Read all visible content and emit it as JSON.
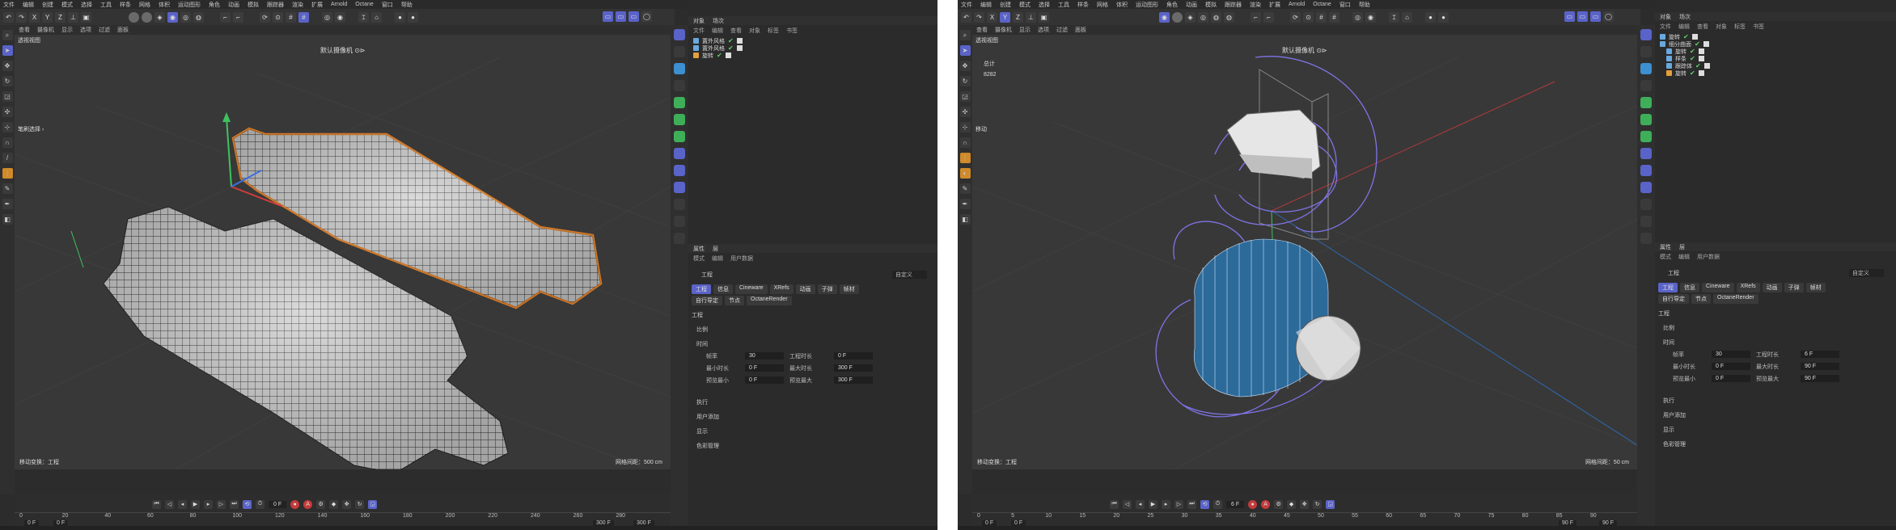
{
  "left": {
    "menu": [
      "文件",
      "编辑",
      "创建",
      "模式",
      "选择",
      "工具",
      "样条",
      "网格",
      "体积",
      "运动图形",
      "角色",
      "动画",
      "模拟",
      "跟踪器",
      "渲染",
      "扩展",
      "Arnold",
      "Octane",
      "窗口",
      "帮助"
    ],
    "toolbar": [
      "X",
      "Y",
      "Z"
    ],
    "viewport": {
      "menu": [
        "查看",
        "摄像机",
        "显示",
        "选项",
        "过滤",
        "面板"
      ],
      "title": "透视视图",
      "camera": "默认摄像机 ⊙⊳",
      "brush_label": "笔刷选择 ›",
      "status": "移动变换：工程",
      "grid_info": "网格间距：500 cm"
    },
    "timeline": {
      "frame": "0 F",
      "ticks": [
        "0",
        "20",
        "40",
        "60",
        "80",
        "100",
        "120",
        "140",
        "160",
        "180",
        "200",
        "220",
        "240",
        "260",
        "280"
      ],
      "range_start": "0 F",
      "range_mid": "0 F",
      "range_end1": "300 F",
      "range_end2": "300 F"
    },
    "objects": {
      "tabs": [
        "对象",
        "场次"
      ],
      "menu": [
        "文件",
        "编辑",
        "查看",
        "对象",
        "标签",
        "书签"
      ],
      "items": [
        {
          "name": "置外风格"
        },
        {
          "name": "置外风格"
        },
        {
          "name": "旋转"
        }
      ]
    },
    "attributes": {
      "tabs": [
        "属性",
        "层"
      ],
      "menu": [
        "模式",
        "编辑",
        "用户数据"
      ],
      "title": "工程",
      "preset": "自定义",
      "tab_row1": [
        "工程",
        "信息",
        "Cineware",
        "XRefs",
        "动画",
        "子弹",
        "帧材"
      ],
      "tab_row2": [
        "自行导定",
        "节点",
        "OctaneRender"
      ],
      "section": "工程",
      "groups": [
        "比例",
        "时间",
        "执行",
        "用户添加",
        "显示",
        "色彩管理"
      ],
      "fields": [
        {
          "label": "帧率",
          "value": "30",
          "label2": "工程时长",
          "value2": "0 F"
        },
        {
          "label": "最小时长",
          "value": "0 F",
          "label2": "最大时长",
          "value2": "300 F"
        },
        {
          "label": "预览最小",
          "value": "0 F",
          "label2": "预览最大",
          "value2": "300 F"
        }
      ]
    }
  },
  "right": {
    "menu": [
      "文件",
      "编辑",
      "创建",
      "模式",
      "选择",
      "工具",
      "样条",
      "网格",
      "体积",
      "运动图形",
      "角色",
      "动画",
      "模拟",
      "跟踪器",
      "渲染",
      "扩展",
      "Arnold",
      "Octane",
      "窗口",
      "帮助"
    ],
    "toolbar": [
      "X",
      "Y",
      "Z"
    ],
    "viewport": {
      "menu": [
        "查看",
        "摄像机",
        "显示",
        "选项",
        "过滤",
        "面板"
      ],
      "title": "透视视图",
      "camera": "默认摄像机 ⊙⊳",
      "readout_label": "总计",
      "readout_value": "8282",
      "move_label": "移动",
      "status": "移动变换：工程",
      "grid_info": "网格间距：50 cm"
    },
    "timeline": {
      "frame": "6 F",
      "ticks": [
        "0",
        "5",
        "10",
        "15",
        "20",
        "25",
        "30",
        "35",
        "40",
        "45",
        "50",
        "55",
        "60",
        "65",
        "70",
        "75",
        "80",
        "85",
        "90"
      ],
      "range_start": "0 F",
      "range_mid": "0 F",
      "range_end1": "90 F",
      "range_end2": "90 F"
    },
    "objects": {
      "tabs": [
        "对象",
        "场次"
      ],
      "menu": [
        "文件",
        "编辑",
        "查看",
        "对象",
        "标签",
        "书签"
      ],
      "items": [
        {
          "name": "旋转"
        },
        {
          "name": "细分曲面"
        },
        {
          "name": "旋转"
        },
        {
          "name": "样条"
        },
        {
          "name": "跟踪体"
        },
        {
          "name": "旋转"
        }
      ]
    },
    "attributes": {
      "tabs": [
        "属性",
        "层"
      ],
      "menu": [
        "模式",
        "编辑",
        "用户数据"
      ],
      "title": "工程",
      "preset": "自定义",
      "tab_row1": [
        "工程",
        "信息",
        "Cineware",
        "XRefs",
        "动画",
        "子弹",
        "帧材"
      ],
      "tab_row2": [
        "自行导定",
        "节点",
        "OctaneRender"
      ],
      "section": "工程",
      "groups": [
        "比例",
        "时间",
        "执行",
        "用户添加",
        "显示",
        "色彩管理"
      ],
      "fields": [
        {
          "label": "帧率",
          "value": "30",
          "label2": "工程时长",
          "value2": "6 F"
        },
        {
          "label": "最小时长",
          "value": "0 F",
          "label2": "最大时长",
          "value2": "90 F"
        },
        {
          "label": "预览最小",
          "value": "0 F",
          "label2": "预览最大",
          "value2": "90 F"
        }
      ]
    }
  }
}
